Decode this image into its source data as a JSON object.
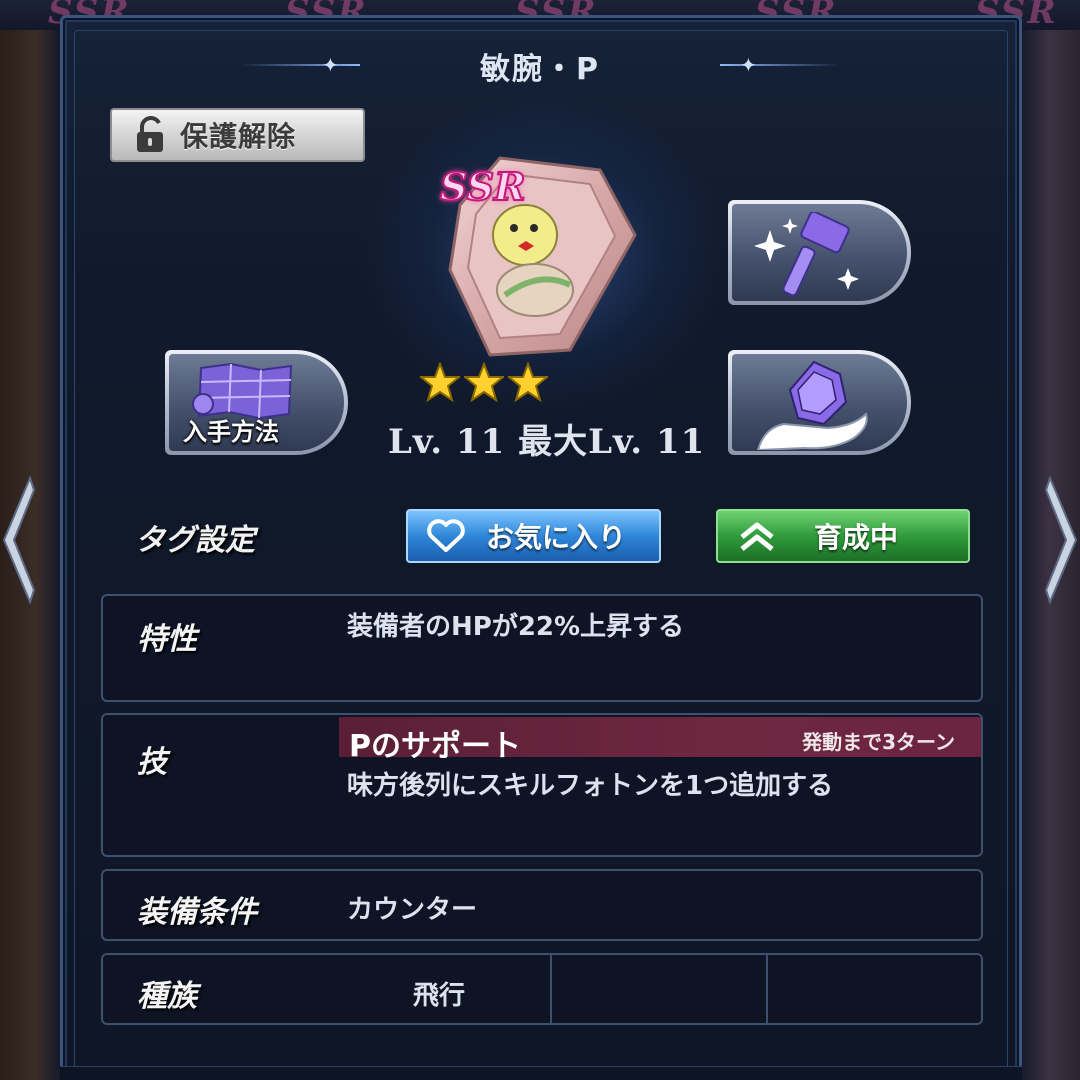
{
  "header": {
    "title": "敏腕・P"
  },
  "background": {
    "watermark": "SSR"
  },
  "protect": {
    "label": "保護解除",
    "icon": "unlock-icon"
  },
  "item": {
    "rarity": "SSR",
    "stars": 3,
    "level_text": "Lv. 11  最大Lv. 11"
  },
  "actions": {
    "obtain_label": "入手方法",
    "obtain_icon": "map-icon",
    "enhance_icon": "hammer-icon",
    "limit_break_icon": "gem-in-hand-icon"
  },
  "tags": {
    "label": "タグ設定",
    "favorite_label": "お気に入り",
    "training_label": "育成中"
  },
  "trait": {
    "label": "特性",
    "text": "装備者のHPが22%上昇する"
  },
  "skill": {
    "label": "技",
    "name": "Pのサポート",
    "turns": "発動まで3ターン",
    "text": "味方後列にスキルフォトンを1つ追加する"
  },
  "condition": {
    "label": "装備条件",
    "text": "カウンター"
  },
  "race": {
    "label": "種族",
    "values": [
      "飛行",
      "",
      ""
    ]
  },
  "colors": {
    "favorite": "#2f86d8",
    "training": "#2f9b3b",
    "skill_bar": "#6e2840",
    "rarity": "#c0197a"
  }
}
